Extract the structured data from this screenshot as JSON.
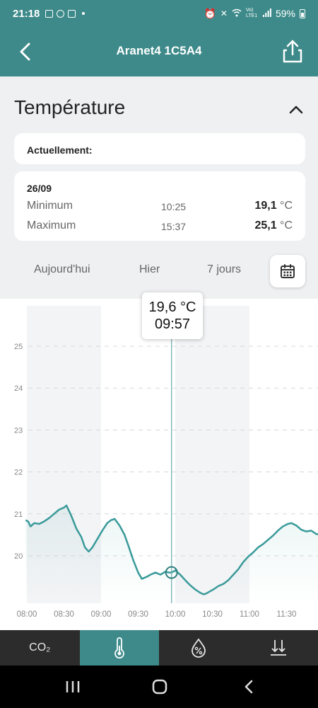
{
  "status_bar": {
    "time": "21:18",
    "battery": "59%",
    "network": "Vo) LTE1"
  },
  "header": {
    "title": "Aranet4 1C5A4"
  },
  "section": {
    "title": "Température"
  },
  "current": {
    "label": "Actuellement:"
  },
  "day_stats": {
    "date": "26/09",
    "minimum": {
      "label": "Minimum",
      "time": "10:25",
      "value": "19,1",
      "unit": "°C"
    },
    "maximum": {
      "label": "Maximum",
      "time": "15:37",
      "value": "25,1",
      "unit": "°C"
    }
  },
  "range_tabs": [
    "Aujourd'hui",
    "Hier",
    "7 jours"
  ],
  "tooltip": {
    "value": "19,6 °C",
    "time": "09:57"
  },
  "bottom_tabs": [
    {
      "label": "CO₂",
      "icon": "co2-icon"
    },
    {
      "label": "",
      "icon": "thermometer-icon"
    },
    {
      "label": "",
      "icon": "humidity-icon"
    },
    {
      "label": "",
      "icon": "pressure-icon"
    }
  ],
  "colors": {
    "accent": "#3e8a8a",
    "line": "#3a9a9a",
    "panel": "#eff0f1",
    "tab_bar": "#2c2c2c"
  },
  "chart_data": {
    "type": "line",
    "xlabel": "",
    "ylabel": "",
    "x_ticks": [
      "08:00",
      "08:30",
      "09:00",
      "09:30",
      "10:00",
      "10:30",
      "11:00",
      "11:30"
    ],
    "y_ticks": [
      20,
      21,
      22,
      23,
      24,
      25
    ],
    "xlim": [
      "07:59",
      "12:06"
    ],
    "ylim": [
      18.9,
      25.2
    ],
    "grid": true,
    "cursor_time": "09:57",
    "series": [
      {
        "x": [
          "07:59",
          "08:01",
          "08:03",
          "08:06",
          "08:10",
          "08:14",
          "08:18",
          "08:22",
          "08:26",
          "08:30",
          "08:32",
          "08:36",
          "08:40",
          "08:44",
          "08:47",
          "08:50",
          "08:53",
          "08:57",
          "09:01",
          "09:05",
          "09:08",
          "09:11",
          "09:15",
          "09:19",
          "09:22",
          "09:26",
          "09:30",
          "09:33",
          "09:37",
          "09:40",
          "09:44",
          "09:48",
          "09:52",
          "09:55",
          "09:57",
          "10:00",
          "10:04",
          "10:08",
          "10:12",
          "10:16",
          "10:20",
          "10:23",
          "10:25",
          "10:28",
          "10:31",
          "10:35",
          "10:39",
          "10:43",
          "10:47",
          "10:51",
          "10:55",
          "10:59",
          "11:03",
          "11:07",
          "11:11",
          "11:15",
          "11:19",
          "11:23",
          "11:27",
          "11:31",
          "11:34",
          "11:38",
          "11:42",
          "11:46",
          "11:50",
          "11:54",
          "11:58",
          "12:02",
          "12:06"
        ],
        "y": [
          20.85,
          20.82,
          20.7,
          20.78,
          20.76,
          20.82,
          20.9,
          21.0,
          21.1,
          21.15,
          21.2,
          20.95,
          20.65,
          20.45,
          20.2,
          20.1,
          20.2,
          20.4,
          20.6,
          20.78,
          20.85,
          20.88,
          20.72,
          20.5,
          20.25,
          19.9,
          19.6,
          19.45,
          19.5,
          19.55,
          19.6,
          19.55,
          19.62,
          19.6,
          19.6,
          19.65,
          19.55,
          19.42,
          19.3,
          19.2,
          19.12,
          19.08,
          19.1,
          19.15,
          19.2,
          19.28,
          19.33,
          19.42,
          19.55,
          19.68,
          19.85,
          19.98,
          20.08,
          20.2,
          20.28,
          20.38,
          20.48,
          20.6,
          20.7,
          20.76,
          20.78,
          20.72,
          20.62,
          20.58,
          20.6,
          20.52,
          20.5,
          20.5,
          20.5
        ]
      }
    ]
  }
}
